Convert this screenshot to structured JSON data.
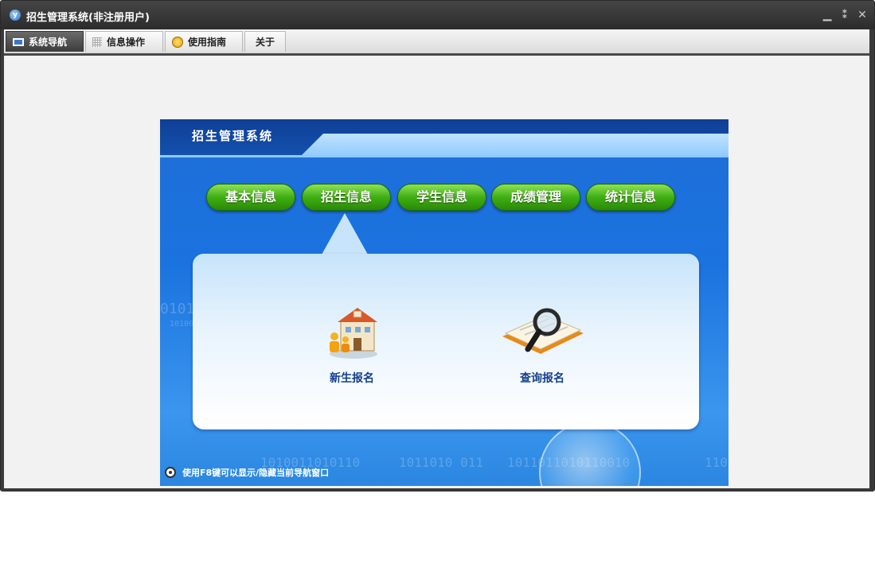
{
  "window": {
    "title": "招生管理系统(非注册用户)",
    "app_icon_glyph": "y",
    "controls": {
      "minimize_glyph": "▁",
      "restore_glyph": "⁑",
      "close_glyph": "✕"
    }
  },
  "menubar": {
    "tabs": [
      {
        "label": "系统导航",
        "icon": "monitor-icon",
        "active": true
      },
      {
        "label": "信息操作",
        "icon": "grid-icon",
        "active": false
      },
      {
        "label": "使用指南",
        "icon": "guide-icon",
        "active": false
      },
      {
        "label": "关于",
        "icon": "",
        "active": false
      }
    ]
  },
  "panel": {
    "title": "招生管理系统",
    "nav_buttons": [
      {
        "label": "基本信息"
      },
      {
        "label": "招生信息"
      },
      {
        "label": "学生信息"
      },
      {
        "label": "成绩管理"
      },
      {
        "label": "统计信息"
      }
    ],
    "items": [
      {
        "label": "新生报名",
        "icon": "school-building-icon"
      },
      {
        "label": "查询报名",
        "icon": "magnifier-book-icon"
      }
    ],
    "hint": "使用F8键可以显示/隐藏当前导航窗口",
    "background_text": [
      "0101",
      "10100",
      "1010011010110",
      "1011010 011",
      "1011011010110010",
      "110"
    ]
  },
  "colors": {
    "button_green": "#3fae13",
    "panel_blue": "#1e6ed8",
    "label_blue": "#133f8a"
  }
}
